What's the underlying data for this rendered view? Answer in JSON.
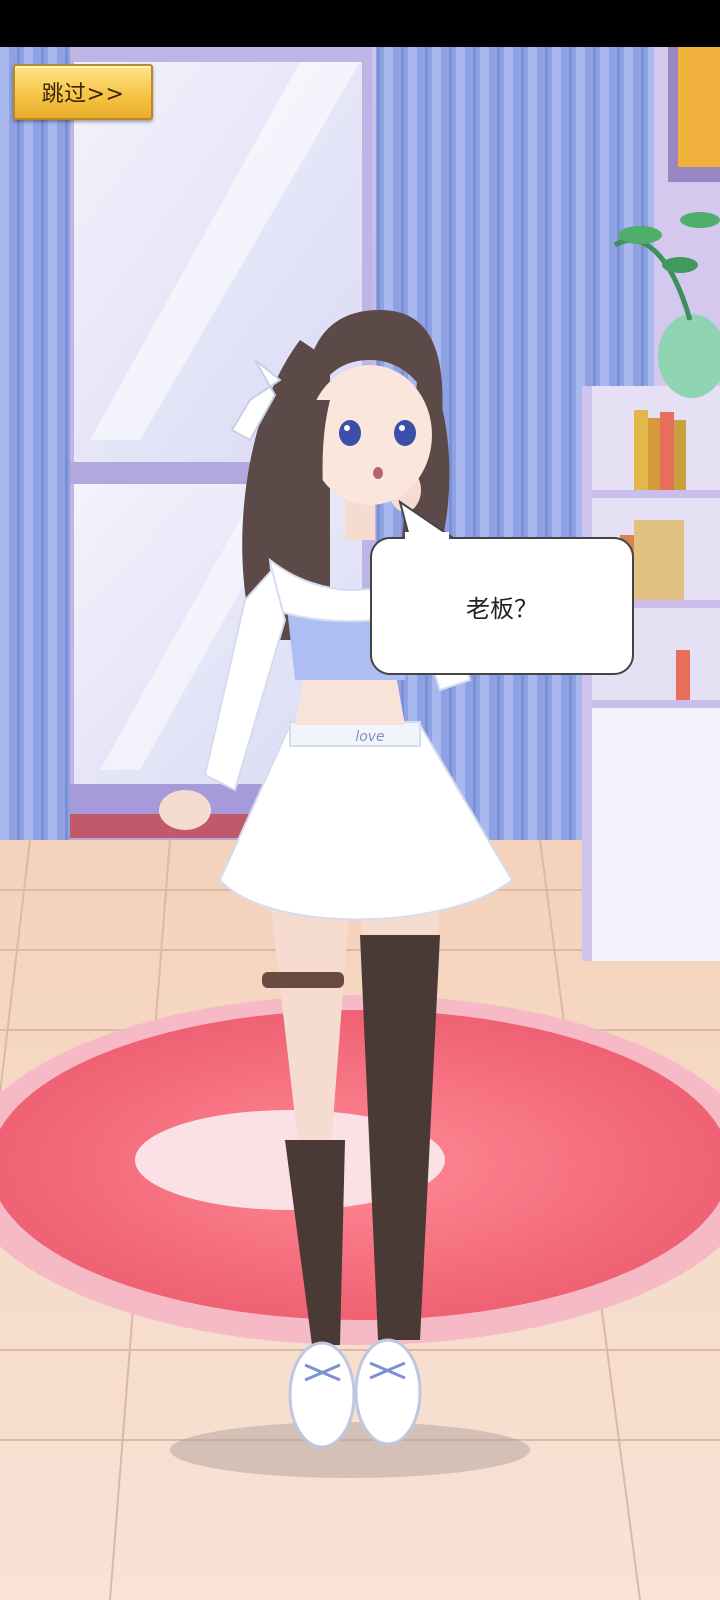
{
  "skip": {
    "label": "跳过>>"
  },
  "dialogue": {
    "text": "老板？"
  },
  "scene": {
    "carpet_text": "",
    "skirt_text": "love"
  },
  "colors": {
    "curtain": "#8ea2e3",
    "wall": "#c8b9e6",
    "floor": "#f2d2bd",
    "rug": "#f36d7c",
    "skip_button": "#f6c547"
  }
}
